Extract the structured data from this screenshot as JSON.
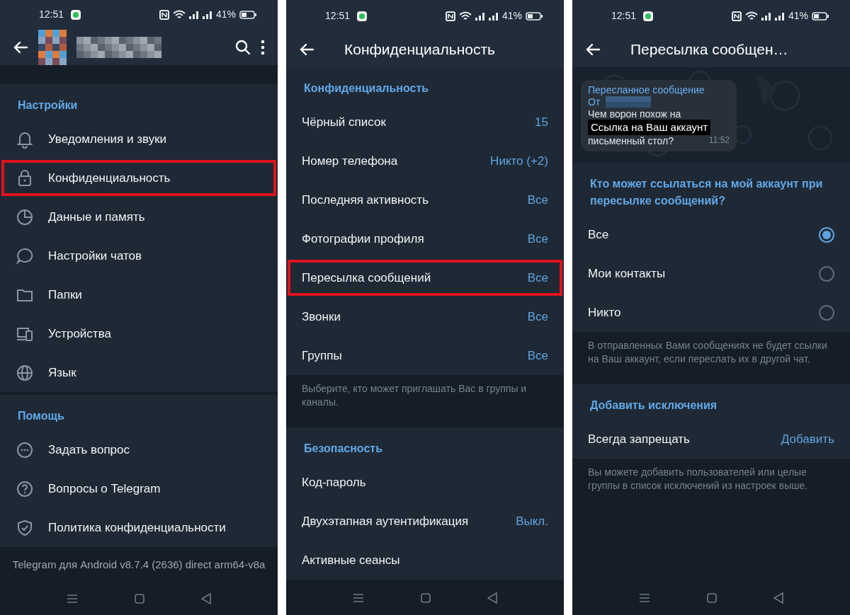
{
  "panels": [
    {
      "kind": "menu",
      "status_bar": {
        "time": "12:51",
        "battery": "41%"
      },
      "sections": [
        {
          "title": "Настройки",
          "items": [
            {
              "label": "Уведомления и звуки",
              "highlighted": false
            },
            {
              "label": "Конфиденциальность",
              "highlighted": true
            },
            {
              "label": "Данные и память",
              "highlighted": false
            },
            {
              "label": "Настройки чатов",
              "highlighted": false
            },
            {
              "label": "Папки",
              "highlighted": false
            },
            {
              "label": "Устройства",
              "highlighted": false
            },
            {
              "label": "Язык",
              "highlighted": false
            }
          ]
        },
        {
          "title": "Помощь",
          "items": [
            {
              "label": "Задать вопрос",
              "highlighted": false
            },
            {
              "label": "Вопросы о Telegram",
              "highlighted": false
            },
            {
              "label": "Политика конфиденциальности",
              "highlighted": false
            }
          ]
        }
      ],
      "footer": "Telegram для Android v8.7.4 (2636) direct arm64-v8a"
    },
    {
      "kind": "list",
      "status_bar": {
        "time": "12:51",
        "battery": "41%"
      },
      "toolbar": {
        "title": "Конфиденциальность"
      },
      "sections": [
        {
          "title": "Конфиденциальность",
          "items": [
            {
              "label": "Чёрный список",
              "value": "15",
              "highlighted": false
            },
            {
              "label": "Номер телефона",
              "value": "Никто (+2)",
              "highlighted": false
            },
            {
              "label": "Последняя активность",
              "value": "Все",
              "highlighted": false
            },
            {
              "label": "Фотографии профиля",
              "value": "Все",
              "highlighted": false
            },
            {
              "label": "Пересылка сообщений",
              "value": "Все",
              "highlighted": true
            },
            {
              "label": "Звонки",
              "value": "Все",
              "highlighted": false
            },
            {
              "label": "Группы",
              "value": "Все",
              "highlighted": false
            }
          ],
          "hint": "Выберите, кто может приглашать Вас в группы и каналы."
        },
        {
          "title": "Безопасность",
          "items": [
            {
              "label": "Код-пароль",
              "highlighted": false
            },
            {
              "label": "Двухэтапная аутентификация",
              "value": "Выкл.",
              "highlighted": false
            },
            {
              "label": "Активные сеансы",
              "highlighted": false
            }
          ]
        }
      ]
    },
    {
      "kind": "options",
      "status_bar": {
        "time": "12:51",
        "battery": "41%"
      },
      "toolbar": {
        "title": "Пересылка сообщен…"
      },
      "preview": {
        "forwarded": "Пересланное сообщение",
        "from": "От",
        "message_line_1": "Чем ворон похож на",
        "tooltip": "Ссылка на Ваш аккаунт",
        "message_line_2": "письменный стол?",
        "time": "11:52"
      },
      "sections": [
        {
          "title": "Кто может ссылаться на мой аккаунт при пересылке сообщений?",
          "options": [
            {
              "label": "Все",
              "selected": true
            },
            {
              "label": "Мои контакты",
              "selected": false
            },
            {
              "label": "Никто",
              "selected": false
            }
          ],
          "hint": "В отправленных Вами сообщениях не будет ссылки на Ваш аккаунт, если переслать их в другой чат."
        },
        {
          "title": "Добавить исключения",
          "items": [
            {
              "label": "Всегда запрещать",
              "value": "Добавить",
              "highlighted": false
            }
          ],
          "hint": "Вы можете добавить пользователей или целые группы в список исключений из настроек выше."
        }
      ]
    }
  ]
}
